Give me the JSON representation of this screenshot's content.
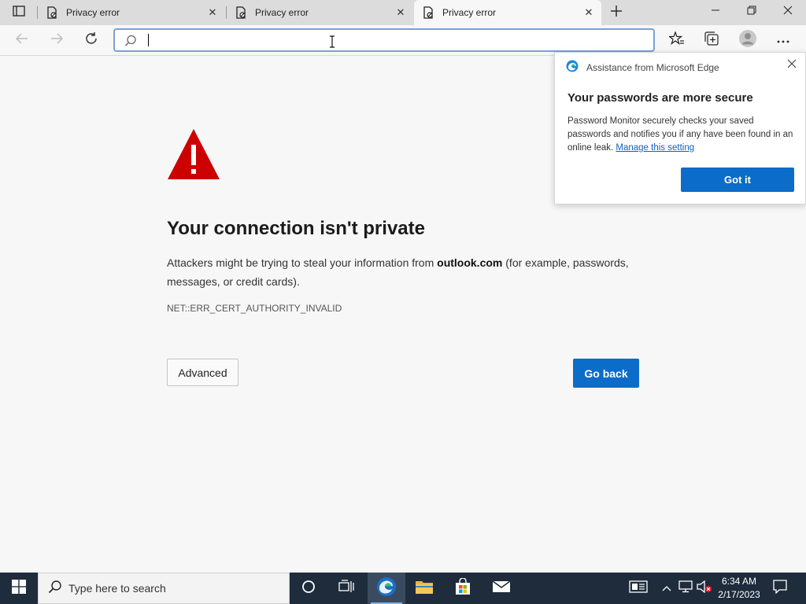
{
  "browser": {
    "tabs": [
      {
        "title": "Privacy error",
        "close": "✕"
      },
      {
        "title": "Privacy error",
        "close": "✕"
      },
      {
        "title": "Privacy error",
        "close": "✕"
      }
    ],
    "address": {
      "value": "",
      "placeholder": ""
    }
  },
  "error_page": {
    "title": "Your connection isn't private",
    "desc_before": "Attackers might be trying to steal your information from ",
    "domain": "outlook.com",
    "desc_after": " (for example, passwords, messages, or credit cards).",
    "code": "NET::ERR_CERT_AUTHORITY_INVALID",
    "advanced_label": "Advanced",
    "goback_label": "Go back"
  },
  "popup": {
    "header": "Assistance from Microsoft Edge",
    "title": "Your passwords are more secure",
    "body": "Password Monitor securely checks your saved passwords and notifies you if any have been found in an online leak.",
    "link": "Manage this setting",
    "button": "Got it"
  },
  "taskbar": {
    "search_placeholder": "Type here to search",
    "time": "6:34 AM",
    "date": "2/17/2023"
  },
  "colors": {
    "accent_blue": "#0c6cc9",
    "warning_red": "#cc0000",
    "taskbar": "#1e2c3c"
  },
  "icons": [
    "tab-actions-icon",
    "privacy-error-favicon",
    "new-tab-icon",
    "minimize-icon",
    "restore-icon",
    "close-window-icon",
    "back-icon",
    "forward-icon",
    "refresh-icon",
    "search-icon",
    "favorites-icon",
    "collections-icon",
    "profile-icon",
    "more-icon",
    "warning-icon",
    "edge-logo-icon",
    "windows-start-icon",
    "cortana-icon",
    "task-view-icon",
    "edge-taskbar-icon",
    "file-explorer-icon",
    "store-icon",
    "mail-icon",
    "news-icon",
    "chevron-up-icon",
    "network-icon",
    "volume-muted-icon",
    "notifications-icon"
  ]
}
